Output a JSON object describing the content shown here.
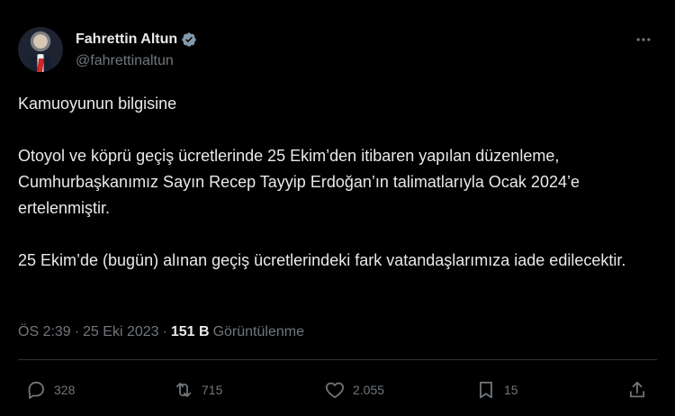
{
  "colors": {
    "background": "#000000",
    "primary_text": "#e7e9ea",
    "secondary_text": "#71767b",
    "verified_badge": "#829aab",
    "divider": "#2f3336"
  },
  "author": {
    "avatar_icon": "profile-photo",
    "name": "Fahrettin Altun",
    "handle": "@fahrettinaltun",
    "verified_icon": "verified-badge-icon"
  },
  "menu": {
    "more_icon": "more-horizontal-icon"
  },
  "tweet": {
    "paragraphs": [
      "Kamuoyunun bilgisine",
      "Otoyol ve köprü geçiş ücretlerinde 25 Ekim’den itibaren yapılan düzenleme, Cumhurbaşkanımız Sayın Recep Tayyip Erdoğan’ın talimatlarıyla Ocak 2024’e ertelenmiştir.",
      "25 Ekim’de (bugün) alınan geçiş ücretlerindeki fark vatandaşlarımıza iade edilecektir."
    ]
  },
  "meta": {
    "time": "ÖS 2:39",
    "separator": "·",
    "date": "25 Eki 2023",
    "views_count": "151 B",
    "views_label": "Görüntülenme"
  },
  "actions": {
    "reply": {
      "icon": "reply-icon",
      "count": "328"
    },
    "repost": {
      "icon": "repost-icon",
      "count": "715"
    },
    "like": {
      "icon": "heart-icon",
      "count": "2.055"
    },
    "bookmark": {
      "icon": "bookmark-icon",
      "count": "15"
    },
    "share": {
      "icon": "share-icon"
    }
  }
}
